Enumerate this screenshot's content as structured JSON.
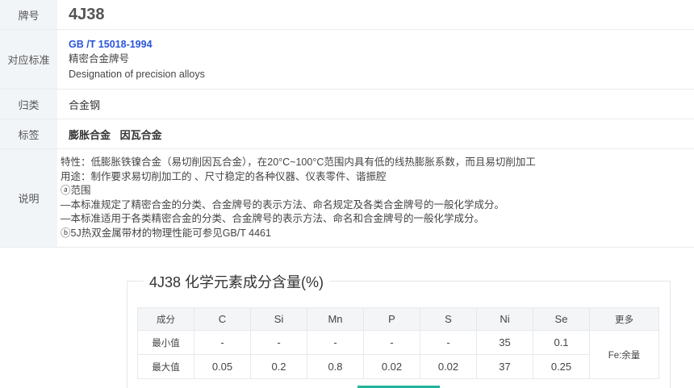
{
  "info": {
    "grade_label": "牌号",
    "grade_value": "4J38",
    "standard_label": "对应标准",
    "standard_link": "GB /T 15018-1994",
    "standard_cn": "精密合金牌号",
    "standard_en": "Designation of precision alloys",
    "category_label": "归类",
    "category_value": "合金钢",
    "tags_label": "标签",
    "tags": [
      "膨胀合金",
      "因瓦合金"
    ],
    "desc_label": "说明",
    "desc_lines": [
      "特性：低膨胀铁镍合金（易切削因瓦合金），在20°C~100°C范围内具有低的线热膨胀系数，而且易切削加工",
      "用途：制作要求易切削加工的 、尺寸稳定的各种仪器、仪表零件、谐振腔",
      "ⓐ范围",
      "—本标准规定了精密合金的分类、合金牌号的表示方法、命名规定及各类合金牌号的一般化学成分。",
      "—本标准适用于各类精密合金的分类、合金牌号的表示方法、命名和合金牌号的一般化学成分。",
      "ⓑ5J热双金属带材的物理性能可参见GB/T 4461"
    ]
  },
  "composition": {
    "title": "4J38 化学元素成分含量(%)",
    "header_first": "成分",
    "elements": [
      "C",
      "Si",
      "Mn",
      "P",
      "S",
      "Ni",
      "Se"
    ],
    "header_more": "更多",
    "rows": [
      {
        "label": "最小值",
        "values": [
          "-",
          "-",
          "-",
          "-",
          "-",
          "35",
          "0.1"
        ]
      },
      {
        "label": "最大值",
        "values": [
          "0.05",
          "0.2",
          "0.8",
          "0.02",
          "0.02",
          "37",
          "0.25"
        ]
      }
    ],
    "more_value": "Fe:余量"
  },
  "colors": {
    "link": "#2a55d9",
    "label_bg": "#f2f5f8",
    "accent_bar": "#23b59b"
  }
}
